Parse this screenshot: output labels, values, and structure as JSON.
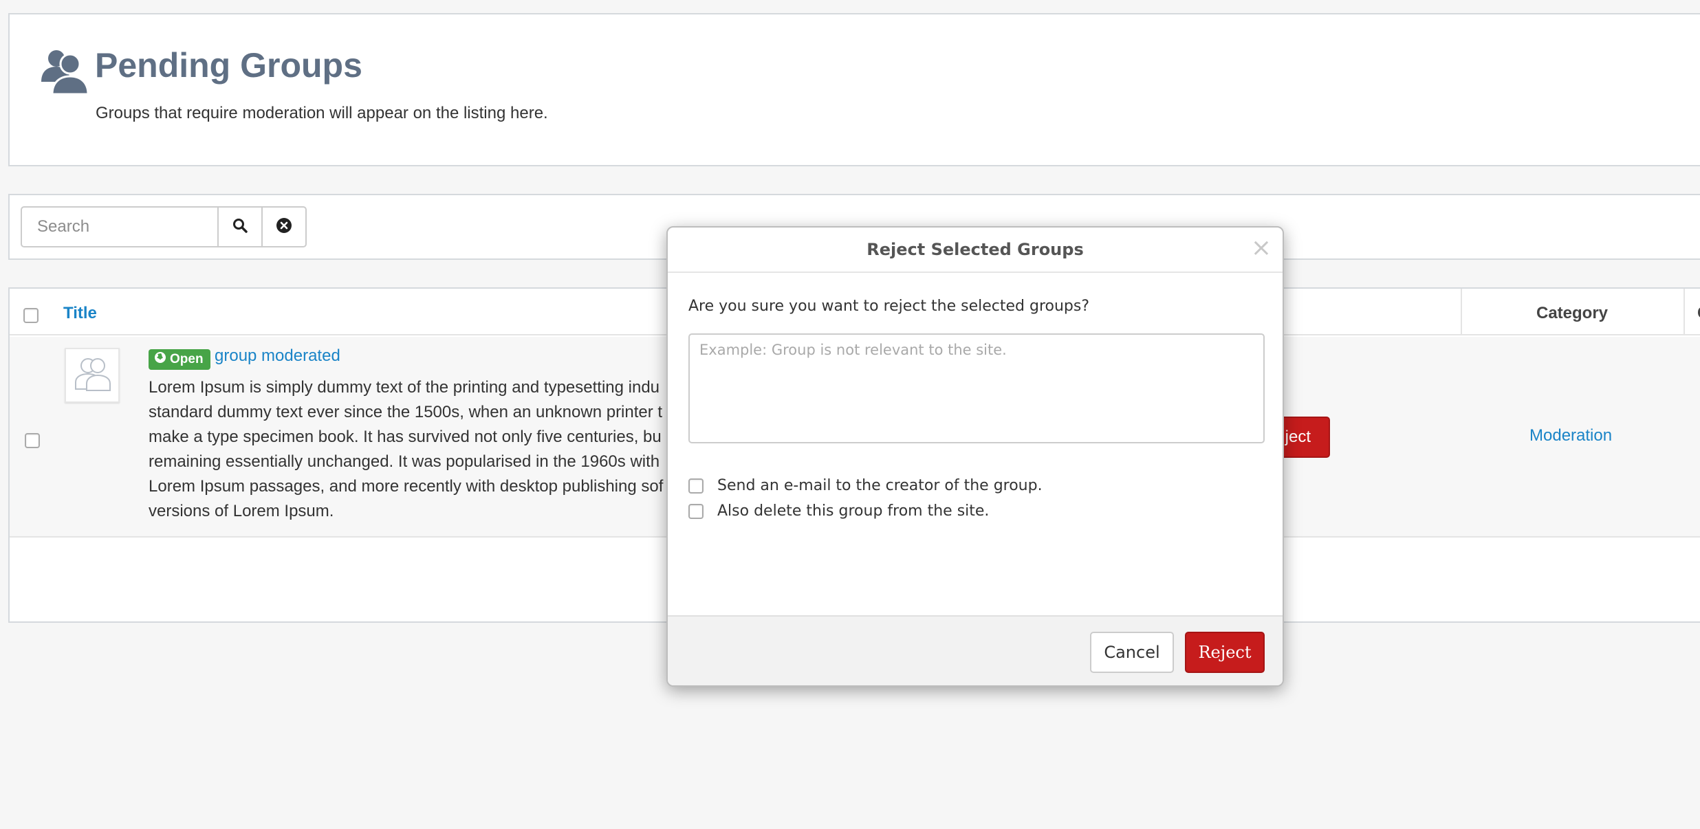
{
  "header": {
    "title": "Pending Groups",
    "description": "Groups that require moderation will appear on the listing here."
  },
  "search": {
    "placeholder": "Search",
    "value": ""
  },
  "table": {
    "columns": {
      "title": "Title",
      "category": "Category",
      "cut_off": "C"
    },
    "rows": [
      {
        "badge": "Open",
        "name": "group moderated",
        "description": "Lorem Ipsum is simply dummy text of the printing and typesetting indu\nstandard dummy text ever since the 1500s, when an unknown printer t\nmake a type specimen book. It has survived not only five centuries, bu\nremaining essentially unchanged. It was popularised in the 1960s with\nLorem Ipsum passages, and more recently with desktop publishing sof\nversions of Lorem Ipsum.",
        "reject_label": "ject",
        "category": "Moderation"
      }
    ]
  },
  "modal": {
    "title": "Reject Selected Groups",
    "close_glyph": "×",
    "question": "Are you sure you want to reject the selected groups?",
    "textarea_placeholder": "Example: Group is not relevant to the site.",
    "options": [
      {
        "label": "Send an e-mail to the creator of the group.",
        "checked": false
      },
      {
        "label": "Also delete this group from the site.",
        "checked": false
      }
    ],
    "cancel_label": "Cancel",
    "reject_label": "Reject"
  },
  "colors": {
    "title": "#5f6f84",
    "link": "#1a84c7",
    "danger": "#c61c1c",
    "badge_open": "#47a447"
  },
  "icons": {
    "header": "users-icon",
    "search": "search-icon",
    "clear": "clear-circle-icon",
    "avatar": "group-placeholder-icon",
    "badge": "globe-icon",
    "close": "close-icon"
  }
}
